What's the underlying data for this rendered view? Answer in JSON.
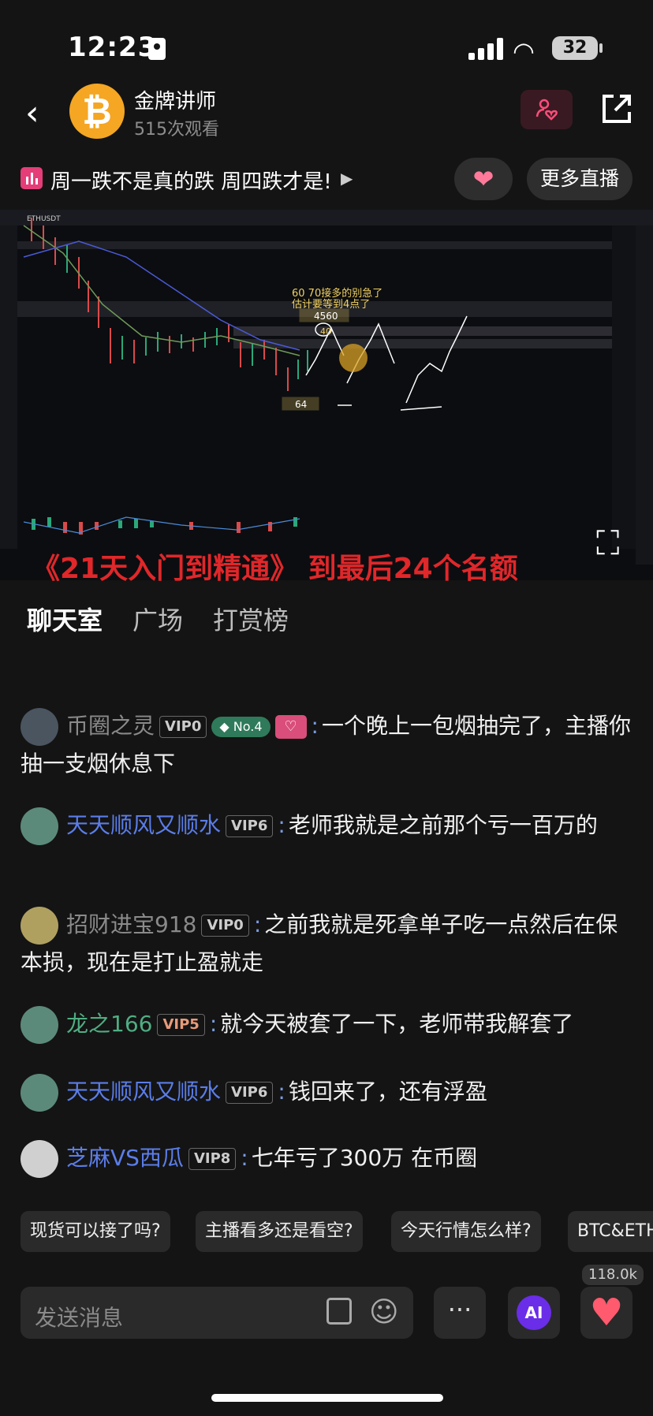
{
  "status": {
    "time": "12:23",
    "battery": "32"
  },
  "header": {
    "host_name": "金牌讲师",
    "views": "515次观看",
    "avatar_glyph": "₿"
  },
  "live": {
    "title": "周一跌不是真的跌 周四跌才是!",
    "more_button": "更多直播"
  },
  "video": {
    "symbol": "ETHUSDT",
    "annotation_line1": "60 70接多的别急了",
    "annotation_line2": "估计要等到4点了",
    "label_4560": "4560",
    "label_40": "40",
    "label_64": "64",
    "promo": "《21天入门到精通》 到最后24个名额"
  },
  "tabs": [
    "聊天室",
    "广场",
    "打赏榜"
  ],
  "messages": [
    {
      "name": "币圈之灵",
      "vip": "VIP0",
      "badge": "No.4",
      "text": "一个晚上一包烟抽完了，主播你抽一支烟休息下",
      "name_color": "#8a8a8a"
    },
    {
      "name": "天天顺风又顺水",
      "vip": "VIP6",
      "text": "老师我就是之前那个亏一百万的",
      "name_color": "#5b7de8"
    },
    {
      "name": "招财进宝918",
      "vip": "VIP0",
      "text": "之前我就是死拿单子吃一点然后在保本损，现在是打止盈就走",
      "name_color": "#8a8a8a"
    },
    {
      "name": "龙之166",
      "vip": "VIP5",
      "text": "就今天被套了一下，老师带我解套了",
      "name_color": "#4fae82"
    },
    {
      "name": "天天顺风又顺水",
      "vip": "VIP6",
      "text": "钱回来了，还有浮盈",
      "name_color": "#5b7de8"
    },
    {
      "name": "芝麻VS西瓜",
      "vip": "VIP8",
      "text": "七年亏了300万 在币圈",
      "name_color": "#5b7de8"
    }
  ],
  "quick_questions": [
    "现货可以接了吗?",
    "主播看多还是看空?",
    "今天行情怎么样?",
    "BTC&ETH"
  ],
  "input": {
    "placeholder": "发送消息"
  },
  "bottom": {
    "more": "···",
    "ai": "AI",
    "like_count": "118.0k"
  }
}
